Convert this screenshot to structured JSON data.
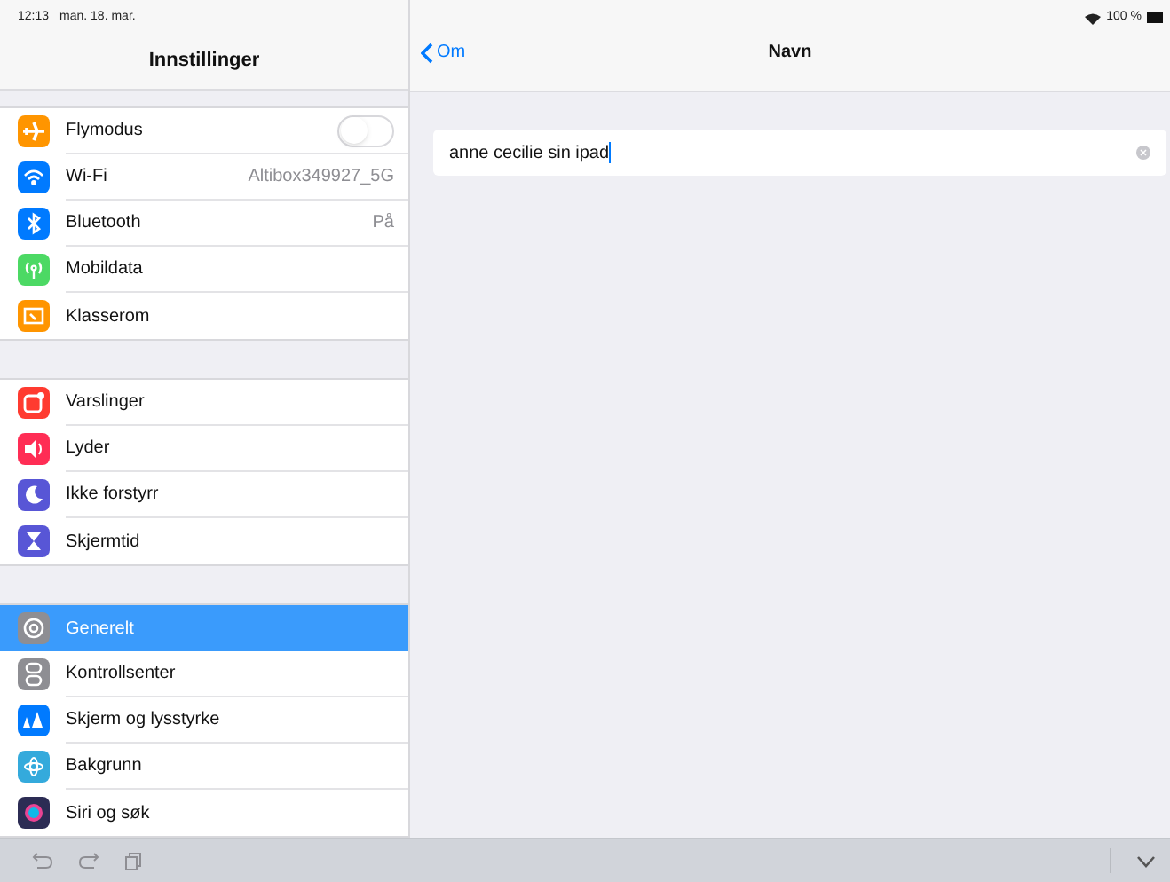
{
  "status_bar": {
    "time": "12:13",
    "date": "man. 18. mar.",
    "battery": "100 %"
  },
  "sidebar": {
    "title": "Innstillinger",
    "sections": [
      [
        {
          "label": "Flymodus",
          "kind": "toggle",
          "on": false,
          "color": "#ff9500",
          "selected": false
        },
        {
          "label": "Wi-Fi",
          "kind": "value",
          "value": "Altibox349927_5G",
          "color": "#007aff",
          "selected": false
        },
        {
          "label": "Bluetooth",
          "kind": "value",
          "value": "På",
          "color": "#007aff",
          "selected": false
        },
        {
          "label": "Mobildata",
          "kind": "plain",
          "color": "#4cd964",
          "selected": false
        },
        {
          "label": "Klasserom",
          "kind": "plain",
          "color": "#ff9500",
          "selected": false
        }
      ],
      [
        {
          "label": "Varslinger",
          "kind": "plain",
          "color": "#ff3b30",
          "selected": false
        },
        {
          "label": "Lyder",
          "kind": "plain",
          "color": "#ff2d55",
          "selected": false
        },
        {
          "label": "Ikke forstyrr",
          "kind": "plain",
          "color": "#5856d6",
          "selected": false
        },
        {
          "label": "Skjermtid",
          "kind": "plain",
          "color": "#5856d6",
          "selected": false
        }
      ],
      [
        {
          "label": "Generelt",
          "kind": "plain",
          "color": "#8e8e93",
          "selected": true
        },
        {
          "label": "Kontrollsenter",
          "kind": "plain",
          "color": "#8e8e93",
          "selected": false
        },
        {
          "label": "Skjerm og lysstyrke",
          "kind": "plain",
          "color": "#007aff",
          "selected": false
        },
        {
          "label": "Bakgrunn",
          "kind": "plain",
          "color": "#34aadc",
          "selected": false
        },
        {
          "label": "Siri og søk",
          "kind": "plain",
          "color": "#2c2c54",
          "selected": false
        }
      ]
    ]
  },
  "detail": {
    "back": "Om",
    "title": "Navn",
    "field_value": "anne cecilie sin ipad"
  }
}
